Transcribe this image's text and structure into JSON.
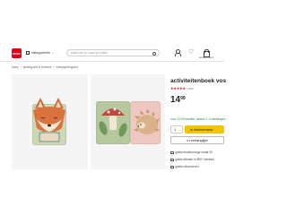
{
  "header": {
    "logo_text": "HEMA",
    "categories_label": "categorieën",
    "search_placeholder": "waar ben je naar op zoek?",
    "account_label": "",
    "cart_label": "winkelmand"
  },
  "breadcrumb": [
    "baby",
    "speelgoed & boeken",
    "babyspeelgoed"
  ],
  "product": {
    "title": "activiteitenboek vos",
    "stars": "★★★★★",
    "rating_value": 4.5,
    "reviews": "1065",
    "price_main": "14",
    "price_cents": "99",
    "delivery_text": "voor 22:00 besteld, binnen 1-3 werkdagen",
    "quantity": "1",
    "add_to_cart": "in winkelmand",
    "wishlist": "in verlanglijst",
    "usps": [
      "gratis thuisbezorgd vanaf 20",
      "gratis afhalen in 500+ winkels",
      "gratis retourneren"
    ]
  },
  "colors": {
    "brand": "#e2001a",
    "cart_button": "#f5c400",
    "delivery": "#2a8a3c"
  }
}
